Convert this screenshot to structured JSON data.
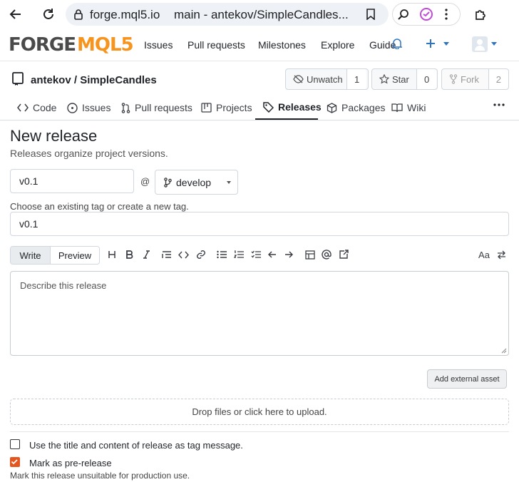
{
  "browser": {
    "url_host": "forge.mql5.io",
    "url_title": "main - antekov/SimpleCandles..."
  },
  "site": {
    "logo_part1": "FORGE",
    "logo_part2": "MQL5",
    "nav": [
      "Issues",
      "Pull requests",
      "Milestones",
      "Explore",
      "Guide"
    ]
  },
  "repo": {
    "owner_repo": "antekov / SimpleCandles",
    "unwatch_label": "Unwatch",
    "unwatch_count": "1",
    "star_label": "Star",
    "star_count": "0",
    "fork_label": "Fork",
    "fork_count": "2"
  },
  "tabs": [
    {
      "label": "Code",
      "icon": "code-icon"
    },
    {
      "label": "Issues",
      "icon": "issue-icon"
    },
    {
      "label": "Pull requests",
      "icon": "pull-request-icon"
    },
    {
      "label": "Projects",
      "icon": "project-icon"
    },
    {
      "label": "Releases",
      "icon": "tag-icon",
      "active": true
    },
    {
      "label": "Packages",
      "icon": "package-icon"
    },
    {
      "label": "Wiki",
      "icon": "book-icon"
    }
  ],
  "form": {
    "title": "New release",
    "subtitle": "Releases organize project versions.",
    "tag_value": "v0.1",
    "at_sign": "@",
    "branch": "develop",
    "tag_help": "Choose an existing tag or create a new tag.",
    "release_title_value": "v0.1",
    "write_tab": "Write",
    "preview_tab": "Preview",
    "description_placeholder": "Describe this release",
    "add_asset_button": "Add external asset",
    "drop_zone": "Drop files or click here to upload.",
    "tag_message_option": "Use the title and content of release as tag message.",
    "tag_message_checked": false,
    "prerelease_option": "Mark as pre-release",
    "prerelease_checked": true,
    "prerelease_help": "Mark this release unsuitable for production use."
  },
  "colors": {
    "accent": "#e3561f",
    "logo_dark": "#4a4a4a",
    "logo_orange": "#f7941d"
  }
}
